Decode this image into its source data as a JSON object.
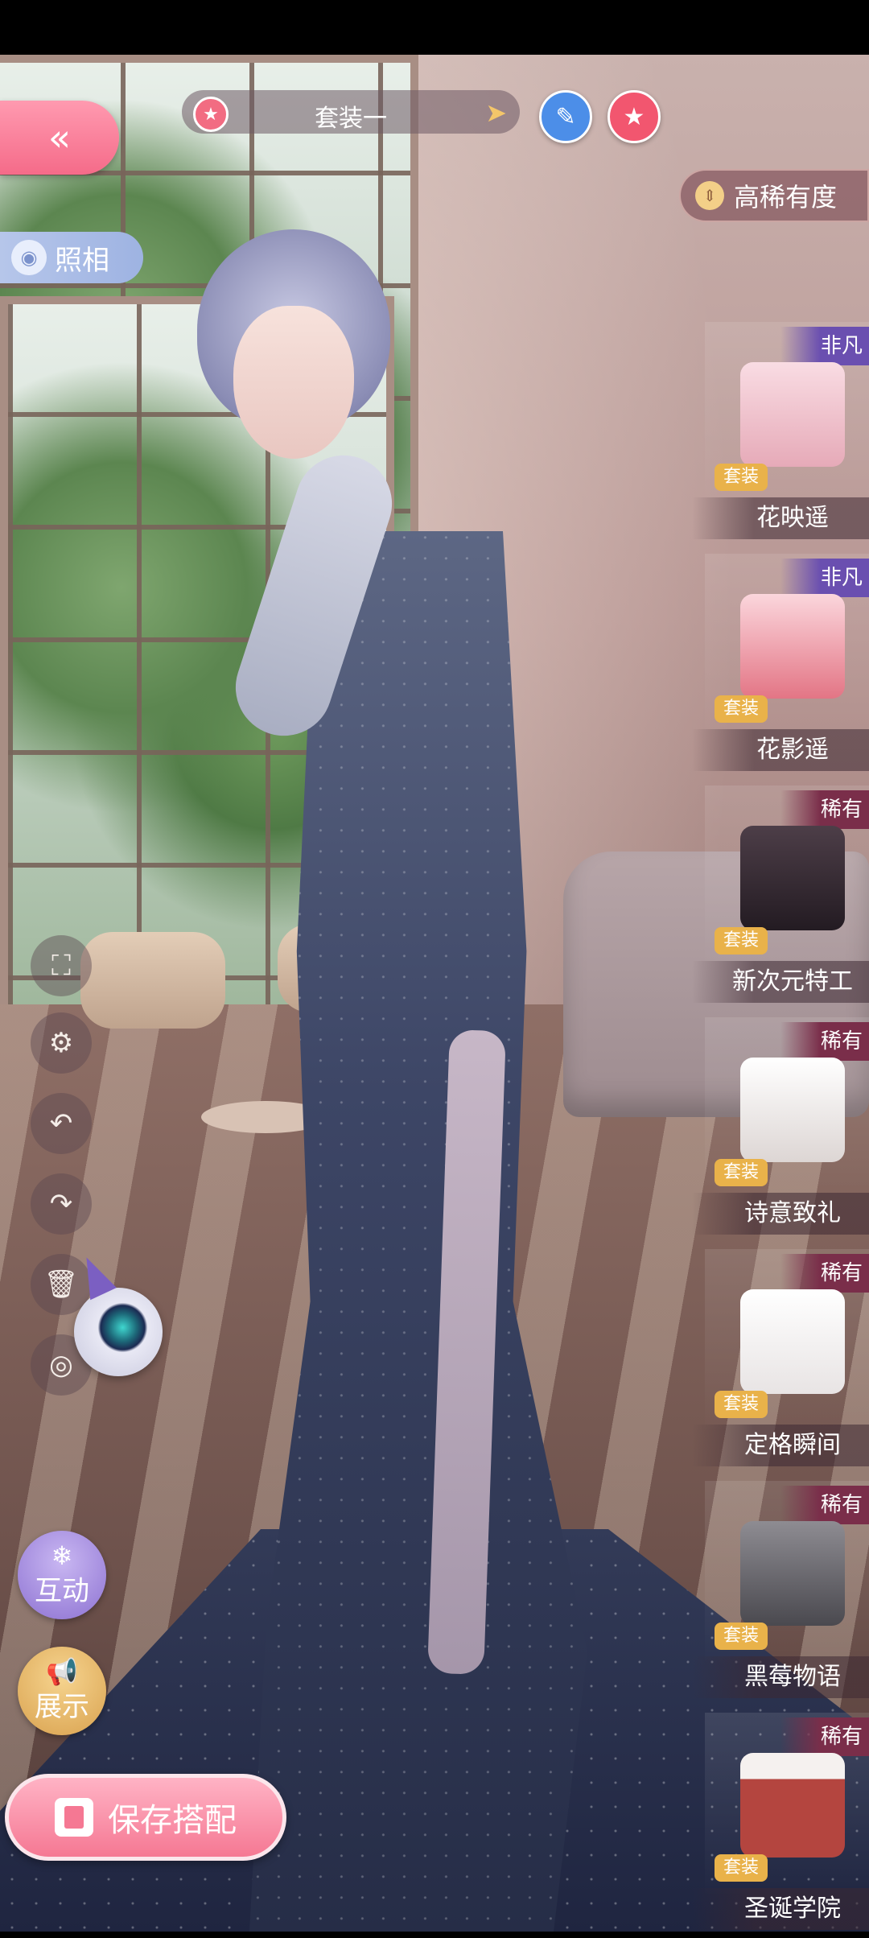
{
  "header": {
    "outfit_set_title": "套装一",
    "sort_label": "高稀有度"
  },
  "left_buttons": {
    "photo_label": "照相"
  },
  "actions": {
    "interact_label": "互动",
    "show_label": "展示",
    "save_label": "保存搭配"
  },
  "outfits": [
    {
      "name": "花映遥",
      "rarity": "非凡",
      "tag": "套装",
      "color": "#f2c9d2"
    },
    {
      "name": "花影遥",
      "rarity": "非凡",
      "tag": "套装",
      "color": "#f0a5b0"
    },
    {
      "name": "新次元特工",
      "rarity": "稀有",
      "tag": "套装",
      "color": "#3b3038"
    },
    {
      "name": "诗意致礼",
      "rarity": "稀有",
      "tag": "套装",
      "color": "#f6f3f2"
    },
    {
      "name": "定格瞬间",
      "rarity": "稀有",
      "tag": "套装",
      "color": "#fbfafa"
    },
    {
      "name": "黑莓物语",
      "rarity": "稀有",
      "tag": "套装",
      "color": "#6b6a70"
    },
    {
      "name": "圣诞学院",
      "rarity": "稀有",
      "tag": "套装",
      "color": "#b4453f"
    }
  ],
  "colors": {
    "accent_pink": "#f57893",
    "tag_gold": "#e9b24a",
    "edit_blue": "#4c8ee8"
  }
}
